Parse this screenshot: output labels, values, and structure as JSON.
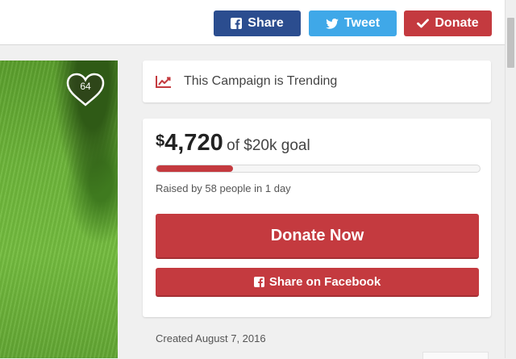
{
  "topbar": {
    "share_label": "Share",
    "tweet_label": "Tweet",
    "donate_label": "Donate",
    "colors": {
      "facebook": "#2b4d8f",
      "twitter": "#3fa8e8",
      "donate": "#c43a3f"
    }
  },
  "campaign": {
    "hearts": "64"
  },
  "trending": {
    "text": "This Campaign is Trending",
    "icon": "trending-chart-icon"
  },
  "donation": {
    "currency": "$",
    "amount": "4,720",
    "goal_text": "of $20k goal",
    "progress_fraction": 0.236,
    "raised_text": "Raised by 58 people in 1 day",
    "donate_now_label": "Donate Now",
    "share_facebook_label": "Share on Facebook",
    "accent": "#c43a3f"
  },
  "created_text": "Created August 7, 2016"
}
